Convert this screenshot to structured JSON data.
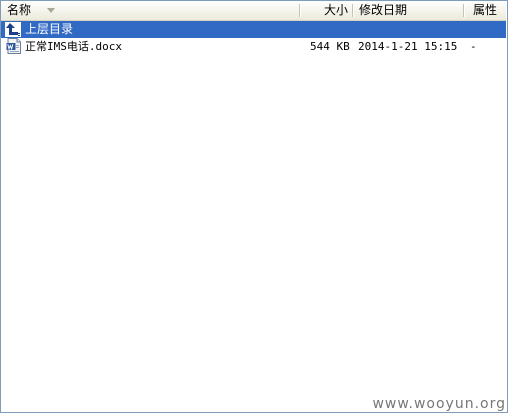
{
  "header": {
    "name": "名称",
    "size": "大小",
    "modified": "修改日期",
    "attributes": "属性"
  },
  "parent_dir": {
    "label": "上层目录",
    "icon": "up-arrow-icon"
  },
  "files": [
    {
      "name": "正常IMS电话.docx",
      "size": "544 KB",
      "modified": "2014-1-21 15:15",
      "attributes": "-",
      "icon": "word-document-icon"
    }
  ],
  "watermark": "www.wooyun.org",
  "colors": {
    "selection": "#316ac5",
    "border": "#7f9db9",
    "header_bg": "#ebeadb"
  }
}
